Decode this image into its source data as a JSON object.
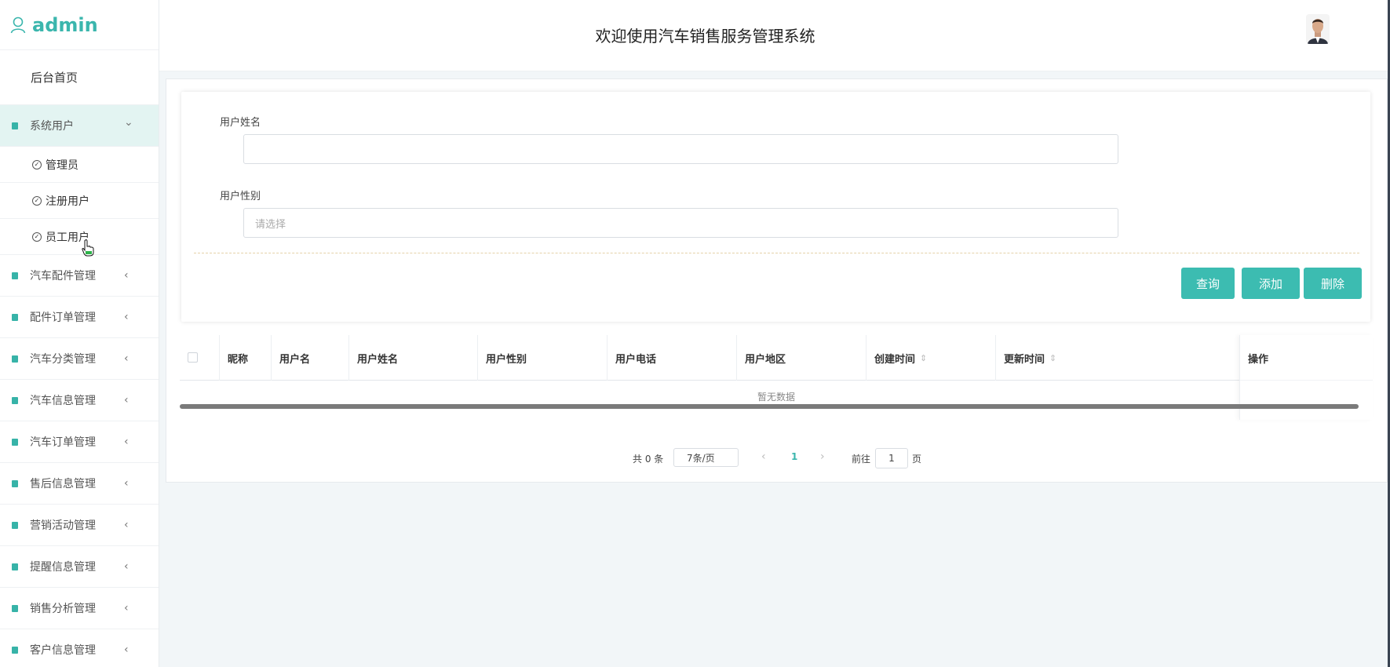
{
  "brand": {
    "user": "admin"
  },
  "header": {
    "title": "欢迎使用汽车销售服务管理系统"
  },
  "sidebar": {
    "home": "后台首页",
    "open_menu": {
      "label": "系统用户",
      "chevron": "⌄"
    },
    "sub_items": [
      {
        "label": "管理员"
      },
      {
        "label": "注册用户"
      },
      {
        "label": "员工用户"
      }
    ],
    "menus": [
      {
        "label": "汽车配件管理"
      },
      {
        "label": "配件订单管理"
      },
      {
        "label": "汽车分类管理"
      },
      {
        "label": "汽车信息管理"
      },
      {
        "label": "汽车订单管理"
      },
      {
        "label": "售后信息管理"
      },
      {
        "label": "营销活动管理"
      },
      {
        "label": "提醒信息管理"
      },
      {
        "label": "销售分析管理"
      },
      {
        "label": "客户信息管理"
      }
    ],
    "chevron_left": "‹"
  },
  "search": {
    "name_label": "用户姓名",
    "name_value": "",
    "gender_label": "用户性别",
    "gender_placeholder": "请选择",
    "query_button": "查询",
    "add_button": "添加",
    "delete_button": "删除"
  },
  "table": {
    "columns": [
      "昵称",
      "用户名",
      "用户姓名",
      "用户性别",
      "用户电话",
      "用户地区",
      "创建时间",
      "更新时间",
      "操作"
    ],
    "sort_icon": "⇕",
    "empty_text": "暂无数据"
  },
  "pagination": {
    "total": "共 0 条",
    "page_size": "7条/页",
    "prev": "‹",
    "current_page": "1",
    "next": "›",
    "goto_label": "前往",
    "goto_value": "1",
    "goto_unit": "页"
  },
  "colors": {
    "accent": "#3cbcb1",
    "sidebar_active_bg": "#e3f4f2"
  }
}
